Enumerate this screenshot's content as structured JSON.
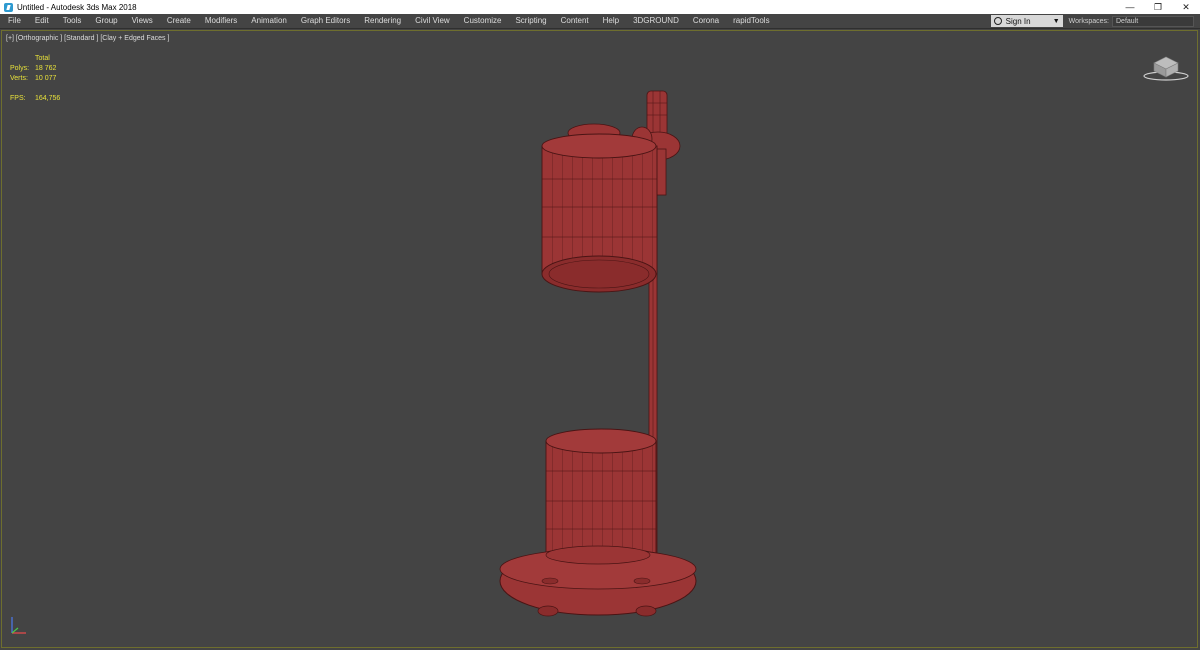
{
  "window": {
    "title": "Untitled - Autodesk 3ds Max 2018",
    "minimize_icon": "minimize-icon",
    "restore_icon": "restore-icon",
    "close_icon": "close-icon"
  },
  "menu": {
    "items": [
      "File",
      "Edit",
      "Tools",
      "Group",
      "Views",
      "Create",
      "Modifiers",
      "Animation",
      "Graph Editors",
      "Rendering",
      "Civil View",
      "Customize",
      "Scripting",
      "Content",
      "Help",
      "3DGROUND",
      "Corona",
      "rapidTools"
    ]
  },
  "account": {
    "signin_label": "Sign In",
    "workspaces_label": "Workspaces:",
    "workspace_value": "Default"
  },
  "viewport": {
    "label": "[+] [Orthographic ] [Standard ] [Clay + Edged Faces ]",
    "stats": {
      "header": "Total",
      "polys_label": "Polys:",
      "polys_value": "18 762",
      "verts_label": "Verts:",
      "verts_value": "10 077",
      "fps_label": "FPS:",
      "fps_value": "164,756"
    }
  },
  "colors": {
    "background": "#444444",
    "model_fill": "#9b3535",
    "model_wire": "#4a1414",
    "stats_text": "#e8e23a"
  }
}
